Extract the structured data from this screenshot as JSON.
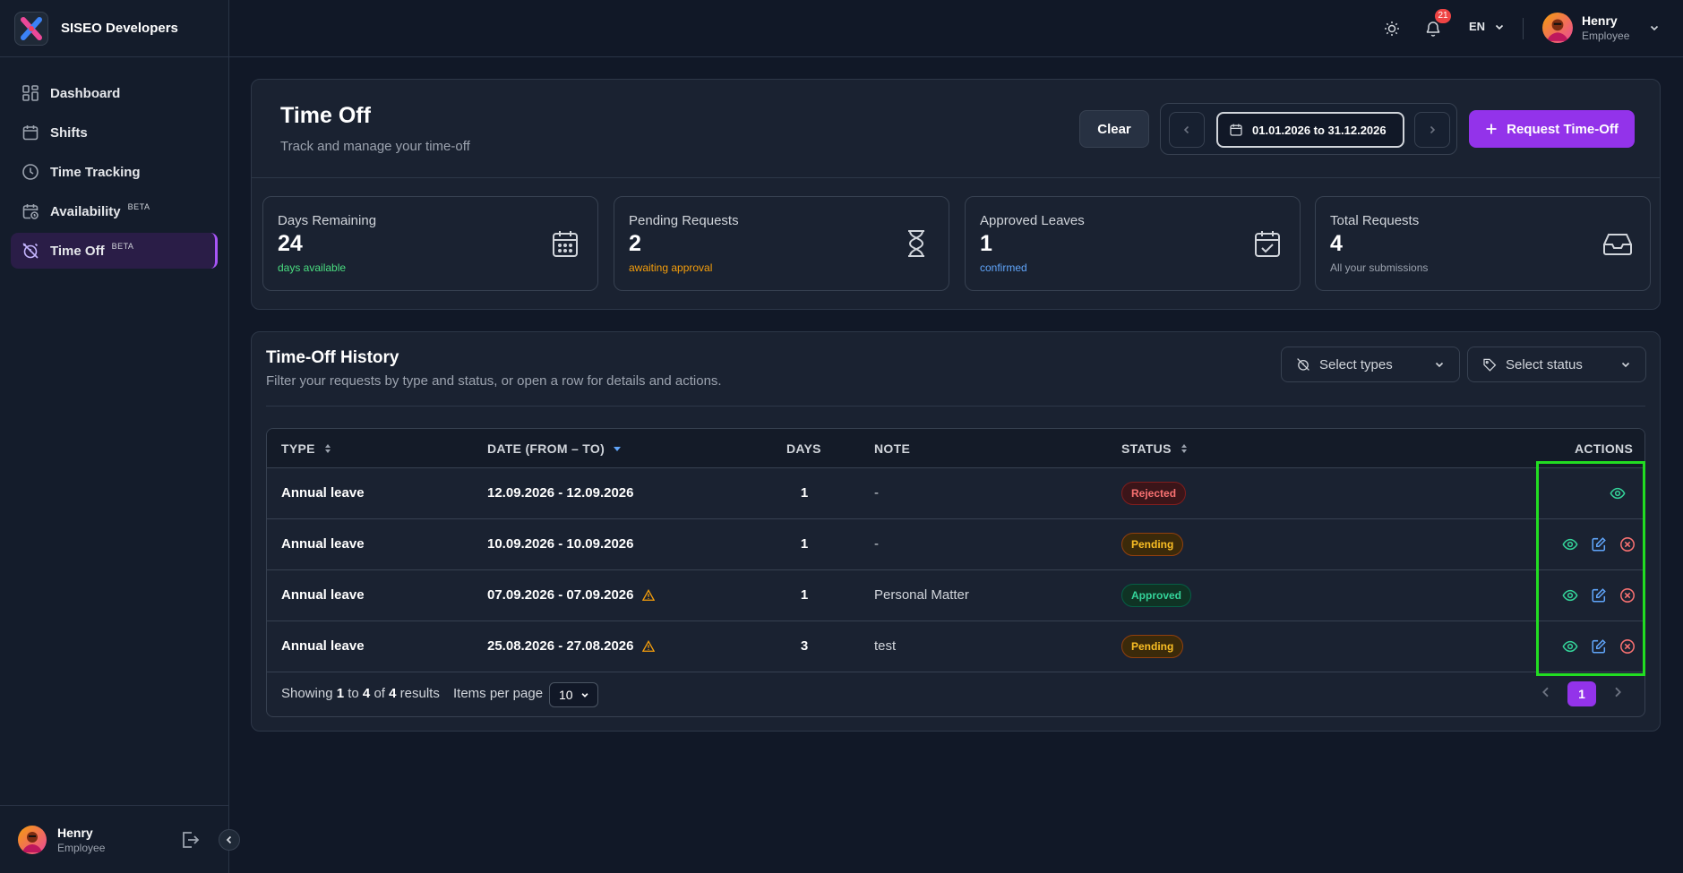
{
  "app": {
    "brand": "SISEO Developers"
  },
  "sidebar": {
    "items": [
      {
        "label": "Dashboard",
        "icon": "grid-icon"
      },
      {
        "label": "Shifts",
        "icon": "calendar-icon"
      },
      {
        "label": "Time Tracking",
        "icon": "clock-icon"
      },
      {
        "label": "Availability",
        "icon": "calendar-clock-icon",
        "badge": "BETA"
      },
      {
        "label": "Time Off",
        "icon": "alarm-off-icon",
        "badge": "BETA",
        "active": true
      }
    ],
    "user": {
      "name": "Henry",
      "role": "Employee"
    }
  },
  "topbar": {
    "notifications": "21",
    "language": "EN",
    "user": {
      "name": "Henry",
      "role": "Employee"
    }
  },
  "page": {
    "title": "Time Off",
    "subtitle": "Track and manage your time-off",
    "clear_label": "Clear",
    "date_range": "01.01.2026 to 31.12.2026",
    "request_label": "Request Time-Off"
  },
  "stats": [
    {
      "label": "Days Remaining",
      "value": "24",
      "note": "days available",
      "note_color": "#4ade80",
      "icon": "calendar-grid-icon"
    },
    {
      "label": "Pending Requests",
      "value": "2",
      "note": "awaiting approval",
      "note_color": "#f59e0b",
      "icon": "hourglass-icon"
    },
    {
      "label": "Approved Leaves",
      "value": "1",
      "note": "confirmed",
      "note_color": "#60a5fa",
      "icon": "calendar-check-icon"
    },
    {
      "label": "Total Requests",
      "value": "4",
      "note": "All your submissions",
      "note_color": "#9ca3af",
      "icon": "inbox-icon"
    }
  ],
  "history": {
    "title": "Time-Off History",
    "subtitle": "Filter your requests by type and status, or open a row for details and actions.",
    "filter_types": "Select types",
    "filter_status": "Select status",
    "columns": {
      "type": "TYPE",
      "date": "DATE (FROM – TO)",
      "days": "DAYS",
      "note": "NOTE",
      "status": "STATUS",
      "actions": "ACTIONS"
    },
    "rows": [
      {
        "type": "Annual leave",
        "date": "12.09.2026 - 12.09.2026",
        "warning": false,
        "days": "1",
        "note": "-",
        "status": "Rejected",
        "status_key": "rejected",
        "actions": [
          "view"
        ]
      },
      {
        "type": "Annual leave",
        "date": "10.09.2026 - 10.09.2026",
        "warning": false,
        "days": "1",
        "note": "-",
        "status": "Pending",
        "status_key": "pending",
        "actions": [
          "view",
          "edit",
          "cancel"
        ]
      },
      {
        "type": "Annual leave",
        "date": "07.09.2026 - 07.09.2026",
        "warning": true,
        "days": "1",
        "note": "Personal Matter",
        "status": "Approved",
        "status_key": "approved",
        "actions": [
          "view",
          "edit",
          "cancel"
        ]
      },
      {
        "type": "Annual leave",
        "date": "25.08.2026 - 27.08.2026",
        "warning": true,
        "days": "3",
        "note": "test",
        "status": "Pending",
        "status_key": "pending",
        "actions": [
          "view",
          "edit",
          "cancel"
        ]
      }
    ],
    "footer": {
      "showing_prefix": "Showing",
      "from": "1",
      "to_word": "to",
      "to": "4",
      "of_word": "of",
      "total": "4",
      "results_word": "results",
      "per_page_label": "Items per page",
      "per_page_value": "10",
      "current_page": "1"
    }
  },
  "colors": {
    "accent": "#9333ea",
    "highlight": "#22dd22"
  }
}
